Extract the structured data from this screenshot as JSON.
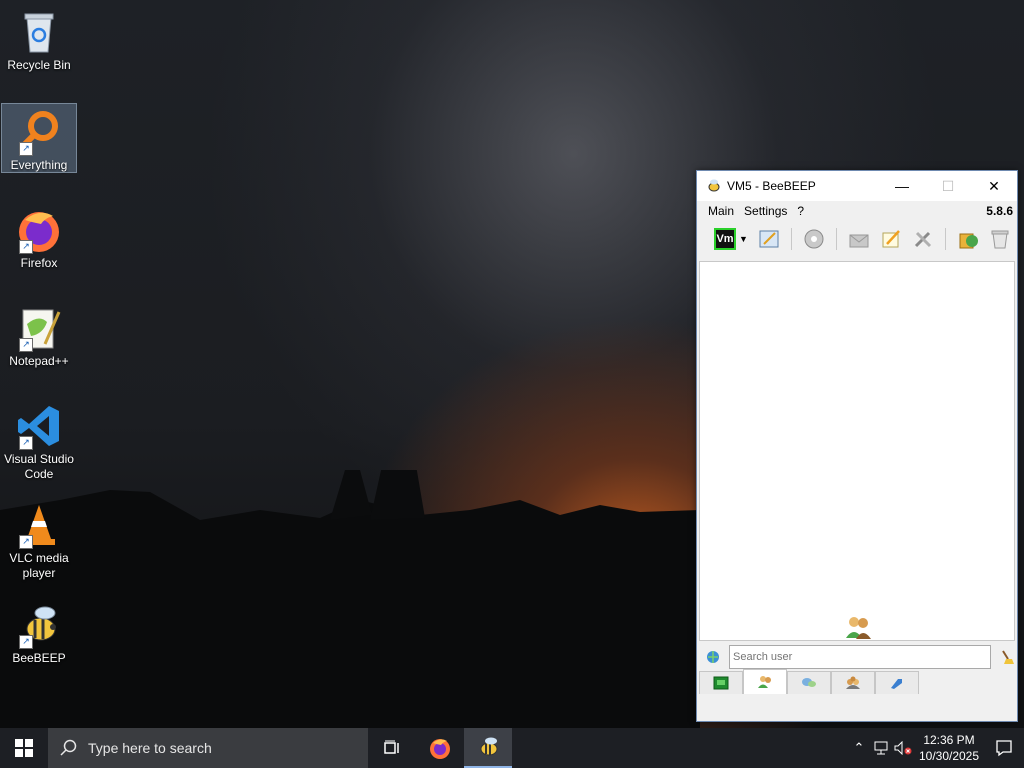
{
  "desktop": {
    "icons": [
      {
        "label": "Recycle Bin",
        "icon": "recycle-bin-icon"
      },
      {
        "label": "Everything",
        "icon": "everything-search-icon"
      },
      {
        "label": "Firefox",
        "icon": "firefox-icon"
      },
      {
        "label": "Notepad++",
        "icon": "notepad-plus-plus-icon"
      },
      {
        "label": "Visual Studio Code",
        "icon": "vscode-icon"
      },
      {
        "label": "VLC media player",
        "icon": "vlc-icon"
      },
      {
        "label": "BeeBEEP",
        "icon": "beebeep-icon"
      }
    ]
  },
  "window": {
    "title": "VM5 - BeeBEEP",
    "menu": [
      "Main",
      "Settings",
      "?"
    ],
    "version": "5.8.6",
    "toolbar_status": "Vm",
    "search_placeholder": "Search user"
  },
  "taskbar": {
    "search_placeholder": "Type here to search",
    "time": "12:36 PM",
    "date": "10/30/2025"
  },
  "colors": {
    "taskbar": "#1d1f24",
    "window_border": "#6f8ab0",
    "accent_orange": "#f0821e",
    "vscode_blue": "#2b8ee0"
  }
}
